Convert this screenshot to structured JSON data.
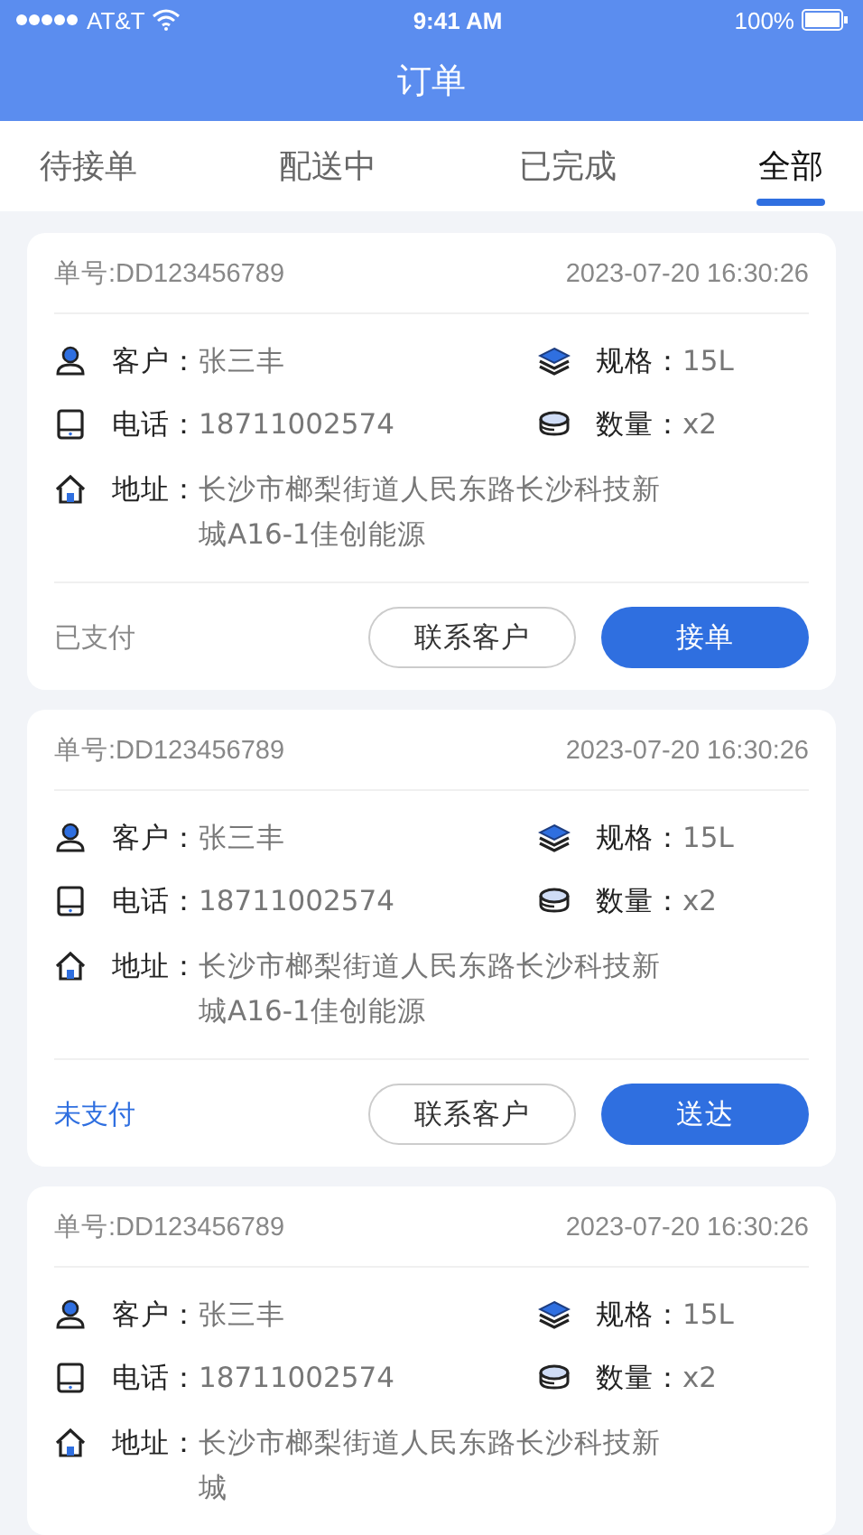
{
  "status_bar": {
    "carrier": "AT&T",
    "time": "9:41 AM",
    "battery": "100%"
  },
  "nav_bar": {
    "title": "订单"
  },
  "tabs": [
    {
      "label": "待接单",
      "selected": false
    },
    {
      "label": "配送中",
      "selected": false
    },
    {
      "label": "已完成",
      "selected": false
    },
    {
      "label": "全部",
      "selected": true
    }
  ],
  "orders": [
    {
      "number": "单号:DD123456789",
      "time": "2023-07-20 16:30:26",
      "fields": [
        {
          "kind": "customer",
          "label": "客户：",
          "value": "张三丰"
        },
        {
          "kind": "spec",
          "label": "规格：",
          "value": "15L"
        },
        {
          "kind": "phone",
          "label": "电话：",
          "value": "18711002574"
        },
        {
          "kind": "quantity",
          "label": "数量：",
          "value": "x2"
        },
        {
          "kind": "address",
          "label": "地址：",
          "value": "长沙市榔梨街道人民东路长沙科技新城A16-1佳创能源"
        }
      ],
      "payment": {
        "label": "已支付",
        "paid": true
      },
      "contact_button": "联系客户",
      "action_button": "接单"
    },
    {
      "number": "单号:DD123456789",
      "time": "2023-07-20 16:30:26",
      "fields": [
        {
          "kind": "customer",
          "label": "客户：",
          "value": "张三丰"
        },
        {
          "kind": "spec",
          "label": "规格：",
          "value": "15L"
        },
        {
          "kind": "phone",
          "label": "电话：",
          "value": "18711002574"
        },
        {
          "kind": "quantity",
          "label": "数量：",
          "value": "x2"
        },
        {
          "kind": "address",
          "label": "地址：",
          "value": "长沙市榔梨街道人民东路长沙科技新城A16-1佳创能源"
        }
      ],
      "payment": {
        "label": "未支付",
        "paid": false
      },
      "contact_button": "联系客户",
      "action_button": "送达"
    },
    {
      "number": "单号:DD123456789",
      "time": "2023-07-20 16:30:26",
      "fields": [
        {
          "kind": "customer",
          "label": "客户：",
          "value": "张三丰"
        },
        {
          "kind": "spec",
          "label": "规格：",
          "value": "15L"
        },
        {
          "kind": "phone",
          "label": "电话：",
          "value": "18711002574"
        },
        {
          "kind": "quantity",
          "label": "数量：",
          "value": "x2"
        },
        {
          "kind": "address",
          "label": "地址：",
          "value": "长沙市榔梨街道人民东路长沙科技新城"
        }
      ]
    }
  ]
}
